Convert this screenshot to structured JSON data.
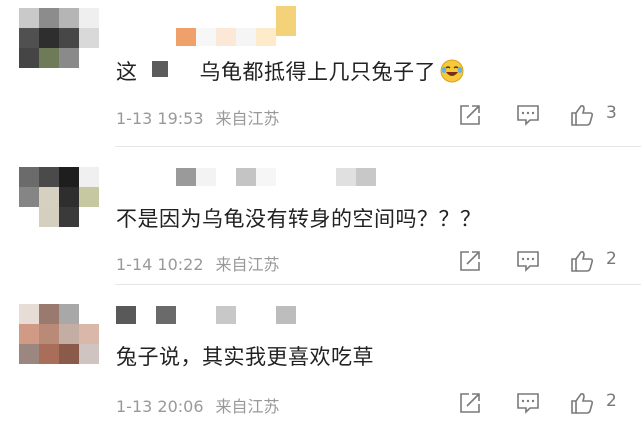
{
  "comments": [
    {
      "text_prefix": "这",
      "text_main": "乌龟都抵得上几只兔子了",
      "emoji": "laugh-cry-emoji",
      "date": "1-13 19:53",
      "source": "来自江苏",
      "likes": "3"
    },
    {
      "text": "不是因为乌龟没有转身的空间吗？？？",
      "date": "1-14 10:22",
      "source": "来自江苏",
      "likes": "2"
    },
    {
      "text": "兔子说，其实我更喜欢吃草",
      "date": "1-13 20:06",
      "source": "来自江苏",
      "likes": "2"
    }
  ],
  "colors": {
    "text": "#222222",
    "meta": "#999999",
    "icon": "#7a7a7a",
    "divider": "#e6e6e6"
  },
  "icons": [
    "share-icon",
    "reply-icon",
    "thumbs-up-icon"
  ]
}
